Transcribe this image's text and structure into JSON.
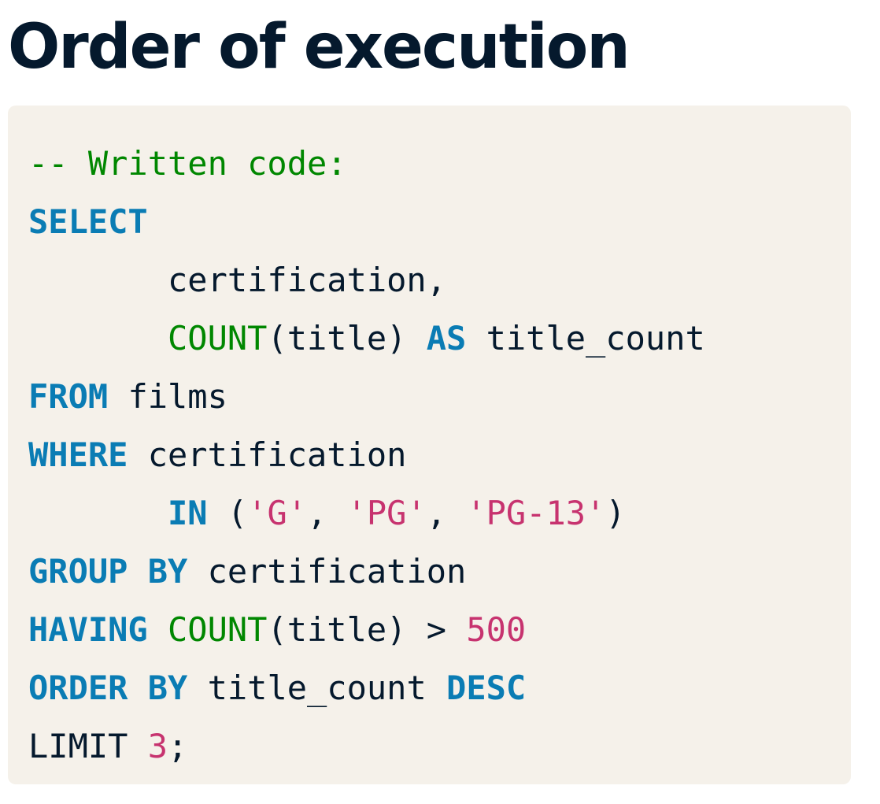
{
  "heading": "Order of execution",
  "code": {
    "lines": [
      [
        {
          "t": "comment",
          "v": "-- Written code:"
        }
      ],
      [
        {
          "t": "kw",
          "v": "SELECT"
        }
      ],
      [
        {
          "t": "plain",
          "v": "       certification,"
        }
      ],
      [
        {
          "t": "plain",
          "v": "       "
        },
        {
          "t": "fn",
          "v": "COUNT"
        },
        {
          "t": "plain",
          "v": "(title) "
        },
        {
          "t": "kw",
          "v": "AS"
        },
        {
          "t": "plain",
          "v": " title_count"
        }
      ],
      [
        {
          "t": "kw",
          "v": "FROM"
        },
        {
          "t": "plain",
          "v": " films"
        }
      ],
      [
        {
          "t": "kw",
          "v": "WHERE"
        },
        {
          "t": "plain",
          "v": " certification"
        }
      ],
      [
        {
          "t": "plain",
          "v": "       "
        },
        {
          "t": "kw",
          "v": "IN"
        },
        {
          "t": "plain",
          "v": " ("
        },
        {
          "t": "str",
          "v": "'G'"
        },
        {
          "t": "plain",
          "v": ", "
        },
        {
          "t": "str",
          "v": "'PG'"
        },
        {
          "t": "plain",
          "v": ", "
        },
        {
          "t": "str",
          "v": "'PG-13'"
        },
        {
          "t": "plain",
          "v": ")"
        }
      ],
      [
        {
          "t": "kw",
          "v": "GROUP BY"
        },
        {
          "t": "plain",
          "v": " certification"
        }
      ],
      [
        {
          "t": "kw",
          "v": "HAVING"
        },
        {
          "t": "plain",
          "v": " "
        },
        {
          "t": "fn",
          "v": "COUNT"
        },
        {
          "t": "plain",
          "v": "(title) > "
        },
        {
          "t": "num",
          "v": "500"
        }
      ],
      [
        {
          "t": "kw",
          "v": "ORDER BY"
        },
        {
          "t": "plain",
          "v": " title_count "
        },
        {
          "t": "kw",
          "v": "DESC"
        }
      ],
      [
        {
          "t": "plain",
          "v": "LIMIT "
        },
        {
          "t": "num",
          "v": "3"
        },
        {
          "t": "plain",
          "v": ";"
        }
      ]
    ]
  },
  "colors": {
    "heading": "#05192d",
    "code_background": "#f5f1ea",
    "keyword": "#0a7cb4",
    "comment": "#008700",
    "function": "#008700",
    "string": "#c7336f",
    "number": "#c7336f",
    "plain": "#05192d"
  }
}
